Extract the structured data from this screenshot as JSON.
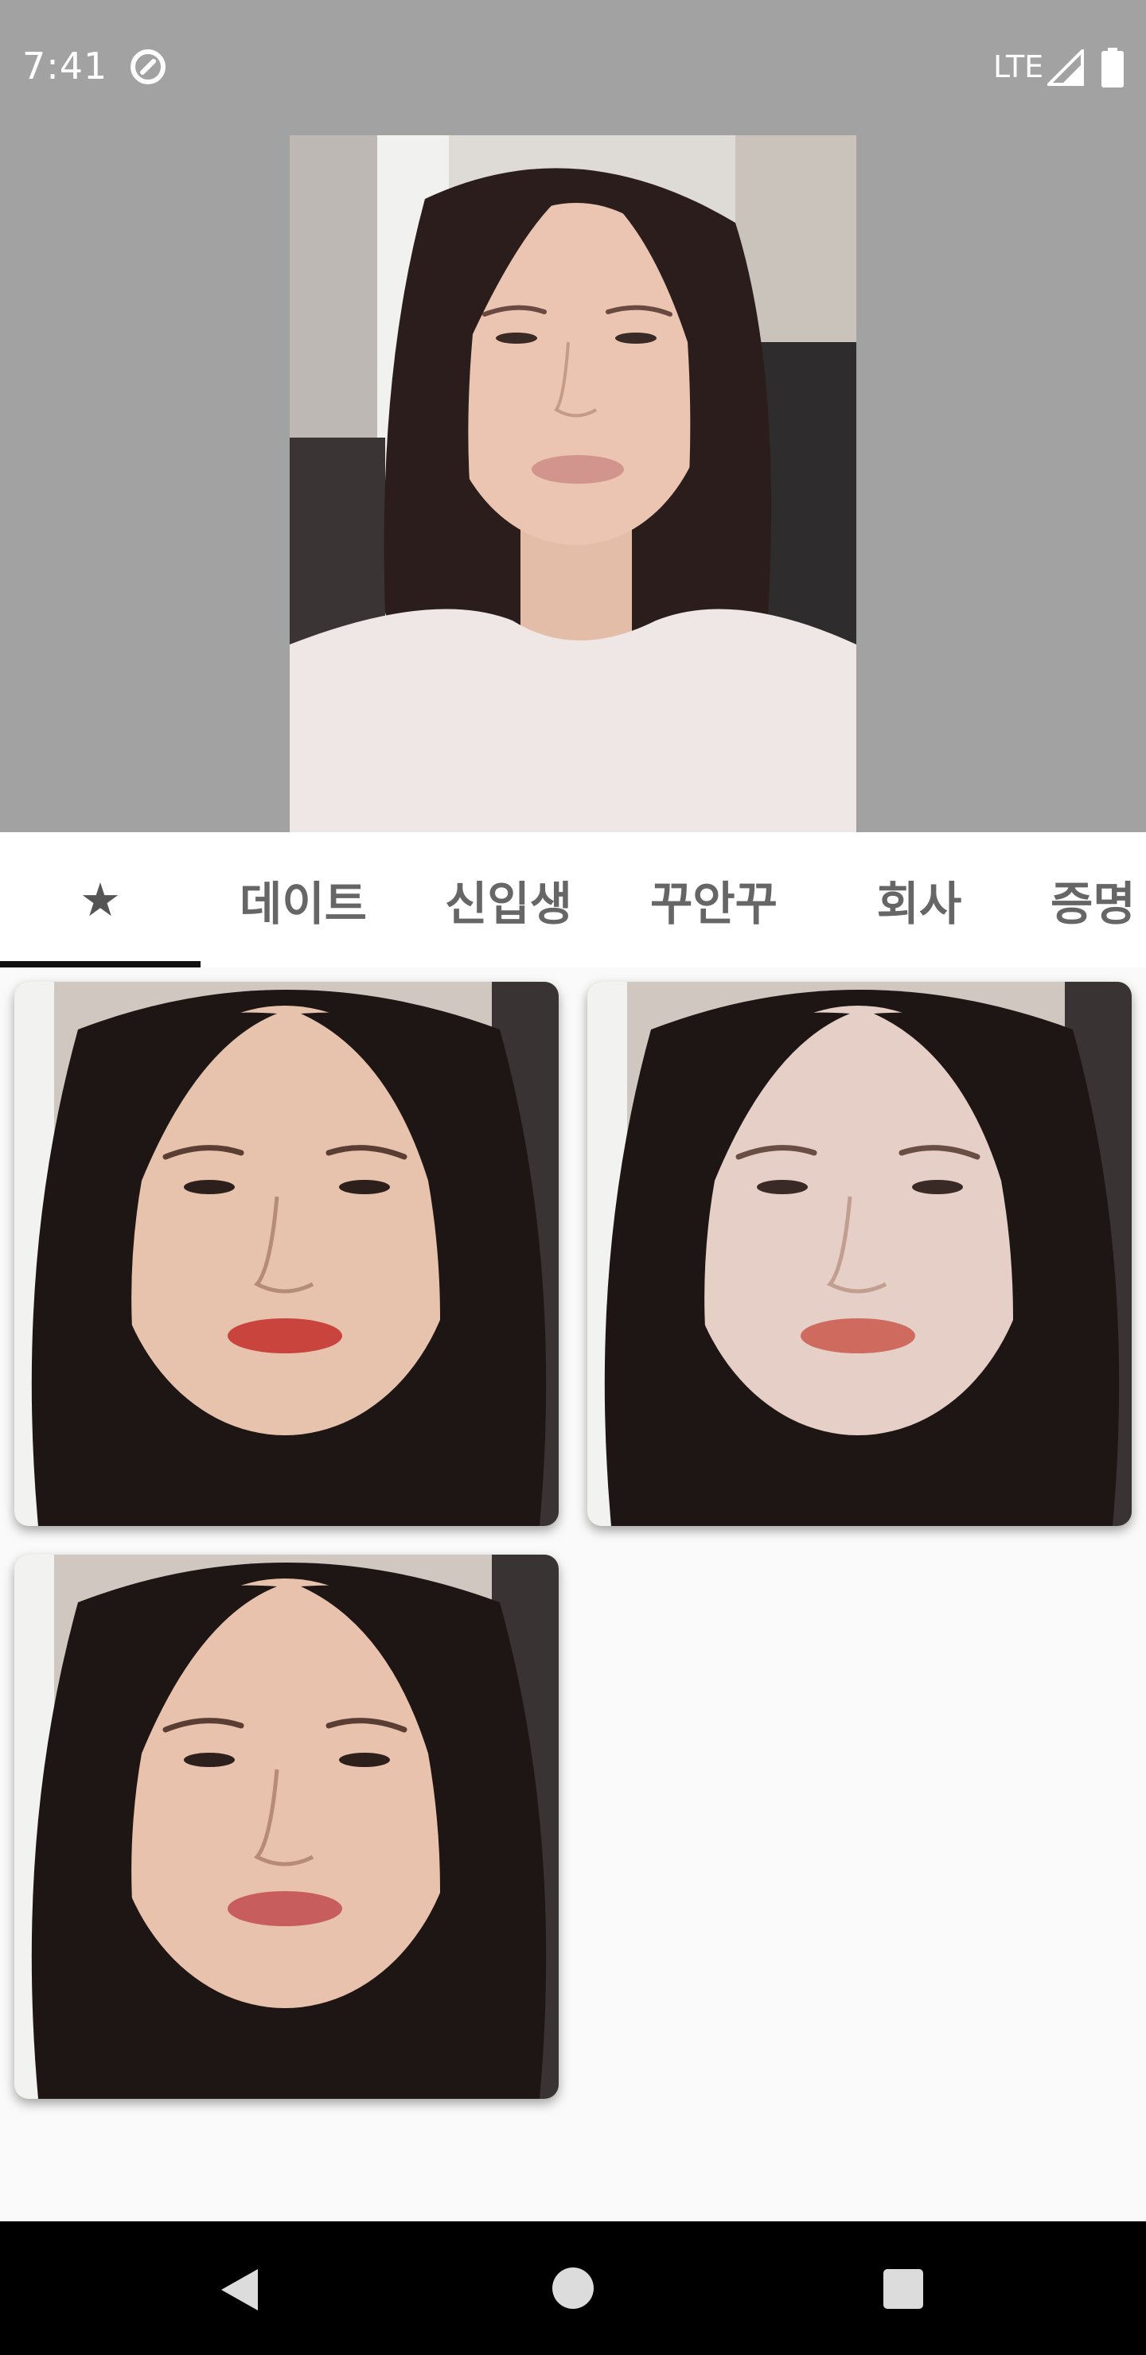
{
  "status_bar": {
    "time": "7:41",
    "network": "LTE",
    "icons": [
      "data-saver-icon",
      "signal-icon",
      "battery-icon"
    ]
  },
  "preview": {
    "image": "portrait-photo"
  },
  "tabs": [
    {
      "label": "★",
      "selected": true
    },
    {
      "label": "데이트",
      "selected": false
    },
    {
      "label": "신입생",
      "selected": false
    },
    {
      "label": "꾸안꾸",
      "selected": false
    },
    {
      "label": "회사",
      "selected": false
    },
    {
      "label": "증명",
      "selected": false
    }
  ],
  "results": [
    {
      "image": "makeup-result-1",
      "lip_color": "#c8443c",
      "skin": "#e7c3ae"
    },
    {
      "image": "makeup-result-2",
      "lip_color": "#cf6a5e",
      "skin": "#e6cfc6"
    },
    {
      "image": "makeup-result-3",
      "lip_color": "#c75d5c",
      "skin": "#e9c2ad"
    }
  ],
  "nav_bar": {
    "icons": [
      "back-icon",
      "home-icon",
      "recents-icon"
    ]
  }
}
